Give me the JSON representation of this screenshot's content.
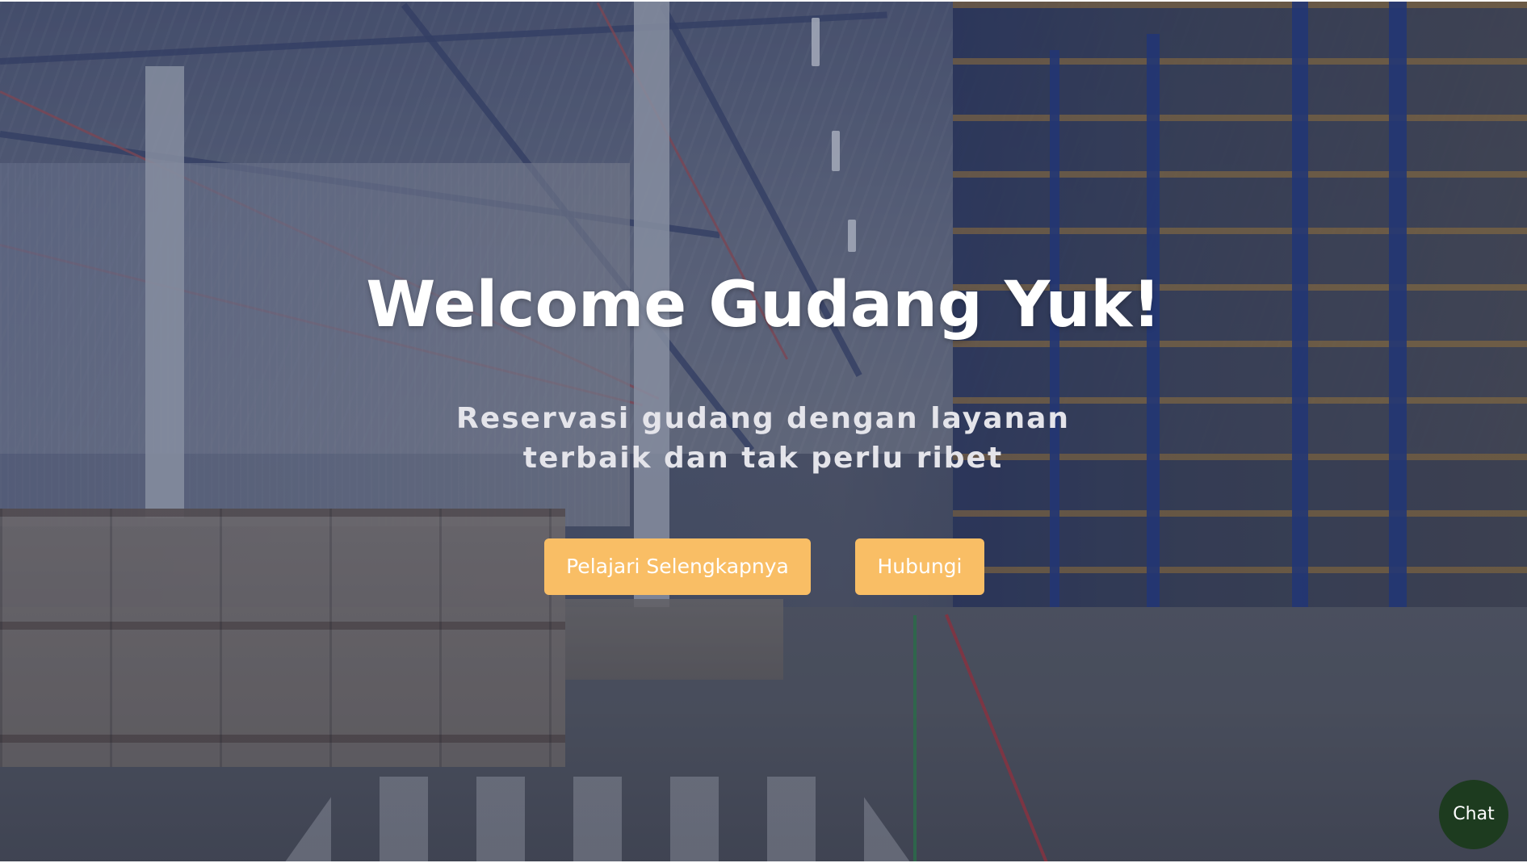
{
  "hero": {
    "title": "Welcome Gudang Yuk!",
    "subtitle": "Reservasi gudang dengan layanan terbaik dan tak perlu ribet",
    "background_description": "warehouse-interior-photo"
  },
  "buttons": {
    "learn_more_label": "Pelajari Selengkapnya",
    "contact_label": "Hubungi"
  },
  "chat": {
    "label": "Chat"
  },
  "colors": {
    "button_bg": "#f9be65",
    "button_text": "#ffffff",
    "chat_bg": "#1d3b1f",
    "title_text": "#ffffff"
  }
}
